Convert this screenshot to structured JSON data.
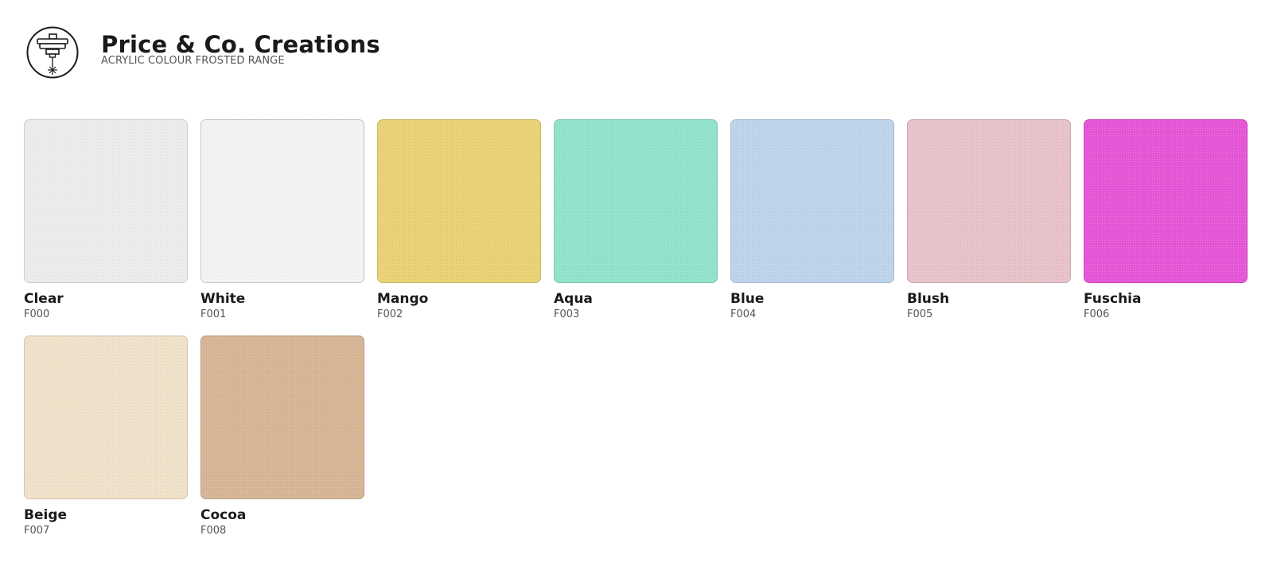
{
  "brand": {
    "title": "Price & Co. Creations",
    "subtitle": "ACRYLIC COLOUR FROSTED RANGE",
    "logo_icon": "laser-cutter-icon"
  },
  "swatches": [
    {
      "name": "Clear",
      "code": "F000",
      "color": "#ececeb"
    },
    {
      "name": "White",
      "code": "F001",
      "color": "#f3f3f3"
    },
    {
      "name": "Mango",
      "code": "F002",
      "color": "#e8d173"
    },
    {
      "name": "Aqua",
      "code": "F003",
      "color": "#90e2cb"
    },
    {
      "name": "Blue",
      "code": "F004",
      "color": "#bdd3ea"
    },
    {
      "name": "Blush",
      "code": "F005",
      "color": "#e7c1c8"
    },
    {
      "name": "Fuschia",
      "code": "F006",
      "color": "#e553d6"
    },
    {
      "name": "Beige",
      "code": "F007",
      "color": "#efe1c9"
    },
    {
      "name": "Cocoa",
      "code": "F008",
      "color": "#d5b494"
    }
  ]
}
